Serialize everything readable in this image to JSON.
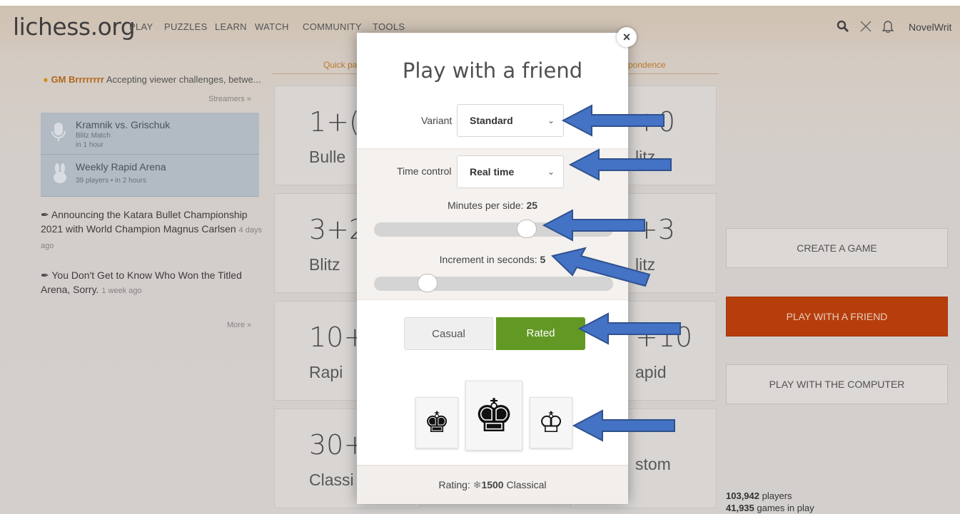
{
  "header": {
    "logo": "lichess.org",
    "nav": [
      "PLAY",
      "PUZZLES",
      "LEARN",
      "WATCH",
      "COMMUNITY",
      "TOOLS"
    ],
    "username": "NovelWrit",
    "icons": [
      "search-icon",
      "lightning-icon",
      "bell-icon"
    ]
  },
  "left": {
    "streamer_name": "GM Brrrrrrrr",
    "streamer_text": "Accepting viewer challenges, betwe...",
    "streamers_link": "Streamers »",
    "events": [
      {
        "title": "Kramnik vs. Grischuk",
        "sub1": "Blitz Match",
        "sub2": "in 1 hour",
        "icon": "microphone-icon"
      },
      {
        "title": "Weekly Rapid Arena",
        "sub1": "39 players • in 2 hours",
        "sub2": "",
        "icon": "rabbit-icon"
      }
    ],
    "news": [
      {
        "title": "Announcing the Katara Bullet Championship 2021 with World Champion Magnus Carlsen",
        "age": "4 days ago"
      },
      {
        "title": "You Don't Get to Know Who Won the Titled Arena, Sorry.",
        "age": "1 week ago"
      }
    ],
    "more_link": "More »"
  },
  "tabs": {
    "quick": "Quick pa",
    "corr": "pondence"
  },
  "pools_left": [
    {
      "time": "1+(",
      "type": "Bulle"
    },
    {
      "time": "3+2",
      "type": "Blitz"
    },
    {
      "time": "10+",
      "type": "Rapi"
    },
    {
      "time": "30+",
      "type": "Classi"
    }
  ],
  "pools_right": [
    {
      "time": "+0",
      "type": "litz"
    },
    {
      "time": "+3",
      "type": "litz"
    },
    {
      "time": "+10",
      "type": "apid"
    },
    {
      "time": "",
      "type": "stom"
    }
  ],
  "right": {
    "create_game": "CREATE A GAME",
    "play_friend": "PLAY WITH A FRIEND",
    "play_computer": "PLAY WITH THE COMPUTER",
    "players_count": "103,942",
    "players_label": "players",
    "games_count": "41,935",
    "games_label": "games in play"
  },
  "modal": {
    "title": "Play with a friend",
    "variant_label": "Variant",
    "variant_value": "Standard",
    "time_control_label": "Time control",
    "time_control_value": "Real time",
    "minutes_label": "Minutes per side:",
    "minutes_value": "25",
    "minutes_fill": 0.65,
    "increment_label": "Increment in seconds:",
    "increment_value": "5",
    "increment_fill": 0.2,
    "casual_label": "Casual",
    "rated_label": "Rated",
    "rating_prefix": "Rating:",
    "rating_value": "1500",
    "rating_suffix": "Classical",
    "colors": [
      "black-king-icon",
      "random-king-icon",
      "white-king-icon"
    ],
    "close": "×"
  },
  "colors": {
    "accent_green": "#629924",
    "brand_orange": "#bf3f0a",
    "arrow_blue": "#4472c4"
  }
}
